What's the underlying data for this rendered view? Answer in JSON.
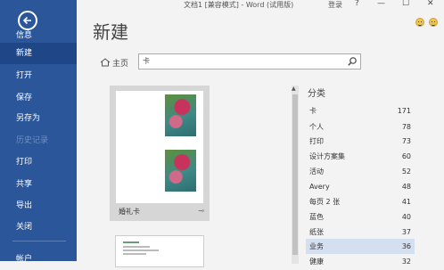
{
  "titlebar": {
    "doc_title": "文档1 [兼容模式] - Word (试用版)",
    "login": "登录",
    "help": "?",
    "minimize": "—",
    "restore": "☐",
    "close": "✕"
  },
  "sidebar": {
    "items": [
      {
        "label": "信息",
        "state": "normal"
      },
      {
        "label": "新建",
        "state": "active"
      },
      {
        "label": "打开",
        "state": "normal"
      },
      {
        "label": "保存",
        "state": "normal"
      },
      {
        "label": "另存为",
        "state": "normal"
      },
      {
        "label": "历史记录",
        "state": "disabled"
      },
      {
        "label": "打印",
        "state": "normal"
      },
      {
        "label": "共享",
        "state": "normal"
      },
      {
        "label": "导出",
        "state": "normal"
      },
      {
        "label": "关闭",
        "state": "normal"
      },
      {
        "label": "帐户",
        "state": "normal"
      }
    ]
  },
  "page": {
    "title": "新建"
  },
  "search": {
    "home_label": "主页",
    "query": "卡"
  },
  "templates": [
    {
      "label": "婚礼卡"
    }
  ],
  "categories": {
    "header": "分类",
    "items": [
      {
        "name": "卡",
        "count": "171"
      },
      {
        "name": "个人",
        "count": "78"
      },
      {
        "name": "打印",
        "count": "73"
      },
      {
        "name": "设计方案集",
        "count": "60"
      },
      {
        "name": "活动",
        "count": "52"
      },
      {
        "name": "Avery",
        "count": "48"
      },
      {
        "name": "每页 2 张",
        "count": "41"
      },
      {
        "name": "蓝色",
        "count": "40"
      },
      {
        "name": "纸张",
        "count": "37"
      },
      {
        "name": "业务",
        "count": "36",
        "selected": true
      },
      {
        "name": "健康",
        "count": "32"
      }
    ]
  },
  "colors": {
    "sidebar": "#2b579a",
    "selected": "#d4dff0"
  }
}
